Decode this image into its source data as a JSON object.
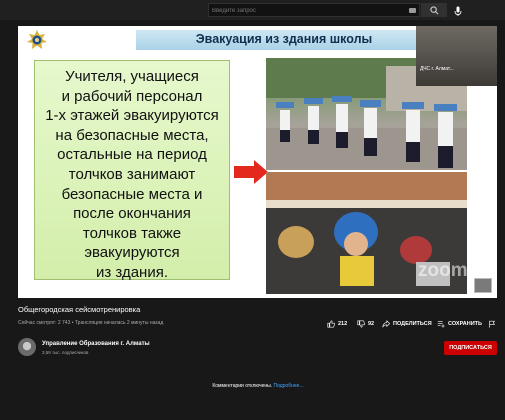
{
  "search": {
    "placeholder": "Введите запрос"
  },
  "slide": {
    "title": "Эвакуация из здания школы",
    "text": "Учителя, учащиеся\nи рабочий персонал\n1-х этажей эвакуируются\nна безопасные места,\nостальные на период\nтолчков занимают\nбезопасные места и\nпосле окончания\nтолчков также\nэвакуируются\nиз здания.",
    "webcam_label": "ДЧС г. Алмат...",
    "watermark": "zoom"
  },
  "video": {
    "title": "Общегородская сейсмотренировка",
    "meta": "Сейчас смотрят: 2 743 • Трансляция началась 2 минуты назад"
  },
  "actions": {
    "likes": "212",
    "dislikes": "92",
    "share": "ПОДЕЛИТЬСЯ",
    "save": "СОХРАНИТЬ"
  },
  "channel": {
    "name": "Управление Образования г. Алматы",
    "subscribers": "3,59 тыс. подписчиков",
    "subscribe_label": "ПОДПИСАТЬСЯ"
  },
  "comments": {
    "disabled_text": "Комментарии отключены.",
    "link_text": "Подробнее..."
  },
  "colors": {
    "accent_red": "#cc0000",
    "link_blue": "#3ea6ff"
  }
}
